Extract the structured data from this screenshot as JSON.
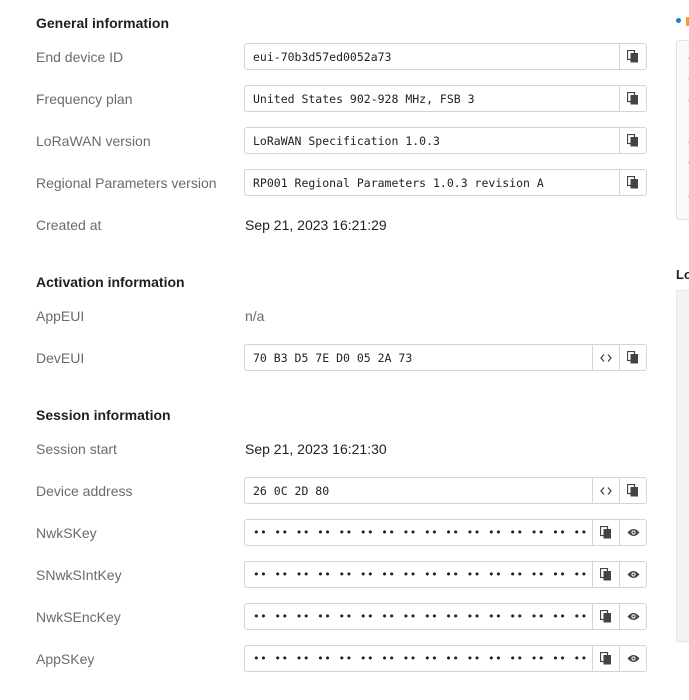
{
  "sections": {
    "general": {
      "title": "General information",
      "end_device_id": {
        "label": "End device ID",
        "value": "eui-70b3d57ed0052a73"
      },
      "frequency_plan": {
        "label": "Frequency plan",
        "value": "United States 902-928 MHz, FSB 3"
      },
      "lorawan_version": {
        "label": "LoRaWAN version",
        "value": "LoRaWAN Specification 1.0.3"
      },
      "regional_params": {
        "label": "Regional Parameters version",
        "value": "RP001 Regional Parameters 1.0.3 revision A"
      },
      "created_at": {
        "label": "Created at",
        "value": "Sep 21, 2023 16:21:29"
      }
    },
    "activation": {
      "title": "Activation information",
      "app_eui": {
        "label": "AppEUI",
        "value": "n/a"
      },
      "dev_eui": {
        "label": "DevEUI",
        "value": "70 B3 D5 7E D0 05 2A 73"
      }
    },
    "session": {
      "title": "Session information",
      "session_start": {
        "label": "Session start",
        "value": "Sep 21, 2023 16:21:30"
      },
      "device_address": {
        "label": "Device address",
        "value": "26 0C 2D 80"
      },
      "nwk_s_key": {
        "label": "NwkSKey",
        "value": "•• •• •• •• •• •• •• •• •• •• •• •• •• •• •• ••"
      },
      "s_nwk_s_int_key": {
        "label": "SNwkSIntKey",
        "value": "•• •• •• •• •• •• •• •• •• •• •• •• •• •• •• ••"
      },
      "nwk_s_enc_key": {
        "label": "NwkSEncKey",
        "value": "•• •• •• •• •• •• •• •• •• •• •• •• •• •• •• ••"
      },
      "app_s_key": {
        "label": "AppSKey",
        "value": "•• •• •• •• •• •• •• •• •• •• •• •• •• •• •• ••"
      }
    }
  },
  "side_panel": {
    "title": "Lo"
  },
  "icons": {
    "copy": "copy-icon",
    "toggle_format": "code-icon",
    "show": "eye-icon"
  },
  "colors": {
    "label": "#6b6b6b",
    "border": "#d4d4d4",
    "accent": "#1c7ed6"
  }
}
